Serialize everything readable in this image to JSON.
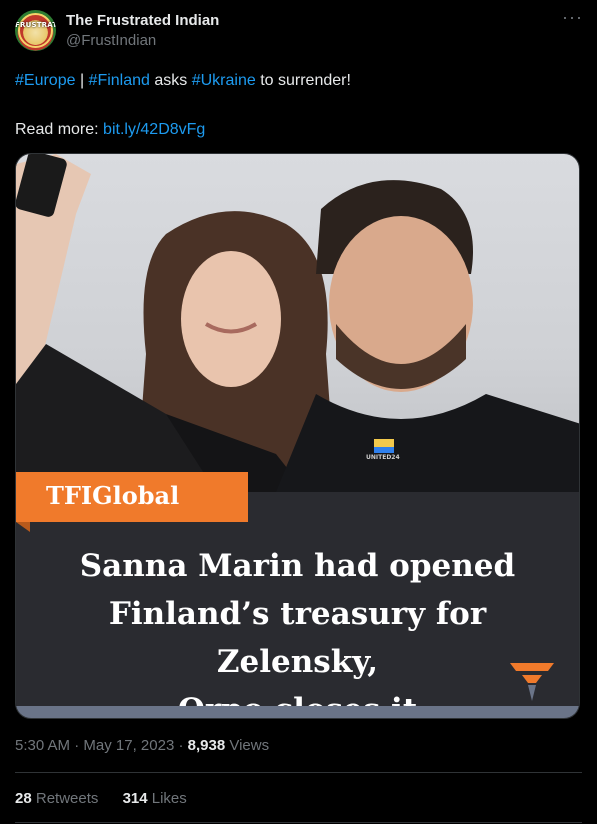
{
  "author": {
    "display_name": "The Frustrated Indian",
    "handle": "@FrustIndian",
    "avatar_text": "FRUSTRATED"
  },
  "more_icon": "more-horizontal-icon",
  "tweet": {
    "hashtag1": "#Europe",
    "sep": " | ",
    "hashtag2": "#Finland",
    "text_mid": " asks ",
    "hashtag3": "#Ukraine",
    "text_end": " to surrender!",
    "read_more_label": "Read more: ",
    "link": "bit.ly/42D8vFg"
  },
  "media": {
    "brand": "TFIGlobal",
    "headline_line1": "Sanna Marin had opened",
    "headline_line2": "Finland’s treasury for Zelensky,",
    "headline_line3": "Orpo closes it",
    "shirt_text": "UNITED24"
  },
  "meta": {
    "time": "5:30 AM",
    "dot1": " · ",
    "date": "May 17, 2023",
    "dot2": " · ",
    "views_count": "8,938",
    "views_label": " Views"
  },
  "stats": {
    "retweets_count": "28",
    "retweets_label": " Retweets",
    "likes_count": "314",
    "likes_label": " Likes"
  },
  "colors": {
    "background": "#000000",
    "link": "#1d9bf0",
    "muted": "#71767b",
    "brand_orange": "#f07a2b"
  }
}
